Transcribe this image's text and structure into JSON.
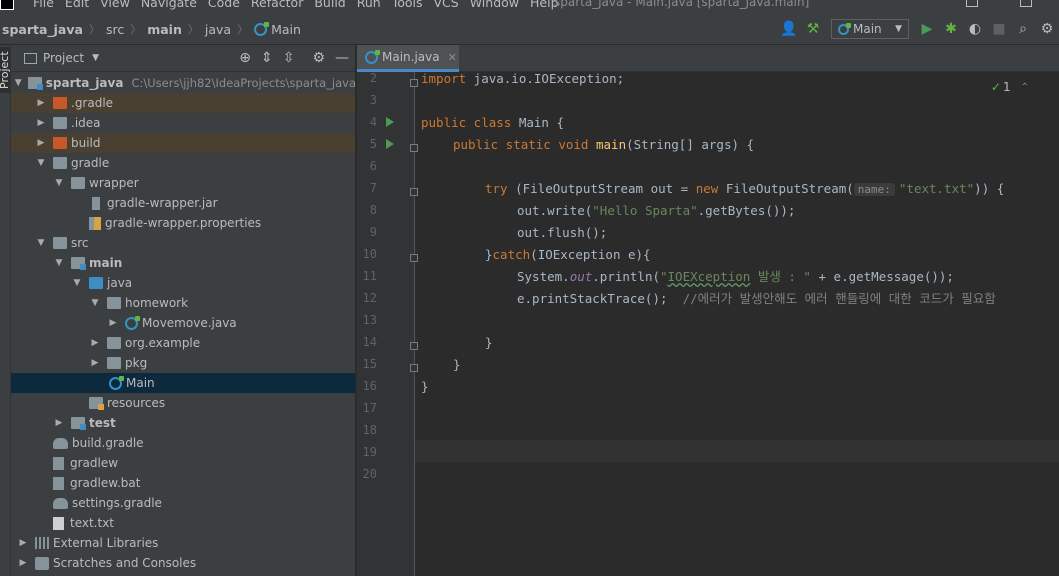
{
  "menubar": {
    "items": [
      "File",
      "Edit",
      "View",
      "Navigate",
      "Code",
      "Refactor",
      "Build",
      "Run",
      "Tools",
      "VCS",
      "Window",
      "Help"
    ],
    "window_title": "sparta_java - Main.java [sparta_java.main]"
  },
  "navbar": {
    "breadcrumbs": [
      "sparta_java",
      "src",
      "main",
      "java",
      "Main"
    ],
    "run_config": "Main"
  },
  "stripe": {
    "label": "Project"
  },
  "project": {
    "title": "Project",
    "tree": [
      {
        "label": "sparta_java",
        "path": "C:\\Users\\jjh82\\IdeaProjects\\sparta_java",
        "bold": true
      },
      {
        "label": ".gradle"
      },
      {
        "label": ".idea"
      },
      {
        "label": "build"
      },
      {
        "label": "gradle"
      },
      {
        "label": "wrapper"
      },
      {
        "label": "gradle-wrapper.jar"
      },
      {
        "label": "gradle-wrapper.properties"
      },
      {
        "label": "src"
      },
      {
        "label": "main",
        "bold": true
      },
      {
        "label": "java"
      },
      {
        "label": "homework"
      },
      {
        "label": "Movemove.java"
      },
      {
        "label": "org.example"
      },
      {
        "label": "pkg"
      },
      {
        "label": "Main"
      },
      {
        "label": "resources"
      },
      {
        "label": "test",
        "bold": true
      },
      {
        "label": "build.gradle"
      },
      {
        "label": "gradlew"
      },
      {
        "label": "gradlew.bat"
      },
      {
        "label": "settings.gradle"
      },
      {
        "label": "text.txt"
      },
      {
        "label": "External Libraries"
      },
      {
        "label": "Scratches and Consoles"
      }
    ]
  },
  "editor": {
    "tab_label": "Main.java",
    "inspection_count": "1",
    "line_numbers": [
      "2",
      "3",
      "4",
      "5",
      "6",
      "7",
      "8",
      "9",
      "10",
      "11",
      "12",
      "13",
      "14",
      "15",
      "16",
      "17",
      "18",
      "19",
      "20"
    ],
    "code": {
      "l2_kw": "import",
      "l2_rest": " java.io.IOException;",
      "l4_kw": "public class",
      "l4_rest": " Main {",
      "l5_kw": "public static void",
      "l5_fn": "main",
      "l5_rest": "(String[] args) {",
      "l7_kw": "try",
      "l7_mid": " (FileOutputStream out = ",
      "l7_new": "new",
      "l7_call": " FileOutputStream(",
      "l7_hint": "name:",
      "l7_str": "\"text.txt\"",
      "l7_end": ")) {",
      "l8_a": "out.write(",
      "l8_str": "\"Hello Sparta\"",
      "l8_b": ".getBytes());",
      "l9": "out.flush();",
      "l10_a": "}",
      "l10_kw": "catch",
      "l10_b": "(IOException e){",
      "l11_a": "System.",
      "l11_out": "out",
      "l11_b": ".println(",
      "l11_str1": "\"",
      "l11_typo": "IOEXception",
      "l11_str2": " 발생 : \"",
      "l11_c": " + e.getMessage());",
      "l12_a": "e.printStackTrace();  ",
      "l12_cm": "//에러가 발생안해도 에러 핸들링에 대한 코드가 필요함",
      "l14": "}",
      "l15": "}",
      "l16": "}"
    }
  }
}
